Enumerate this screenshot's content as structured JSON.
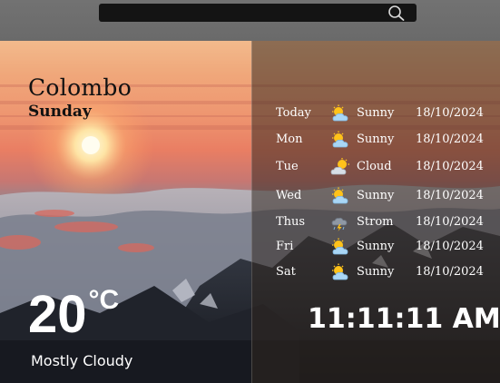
{
  "search": {
    "value": "",
    "placeholder": ""
  },
  "location": {
    "city": "Colombo",
    "day": "Sunday"
  },
  "current": {
    "temperature": "20",
    "unit": "°C",
    "condition": "Mostly Cloudy"
  },
  "clock": "11:11:11 AM",
  "forecast": [
    {
      "day": "Today",
      "condition": "Sunny",
      "date": "18/10/2024",
      "icon": "sun-cloud-icon"
    },
    {
      "day": "Mon",
      "condition": "Sunny",
      "date": "18/10/2024",
      "icon": "sun-cloud-icon"
    },
    {
      "day": "Tue",
      "condition": "Cloud",
      "date": "18/10/2024",
      "icon": "cloud-sun-icon"
    },
    {
      "day": "Wed",
      "condition": "Sunny",
      "date": "18/10/2024",
      "icon": "sun-cloud-icon"
    },
    {
      "day": "Thus",
      "condition": "Strom",
      "date": "18/10/2024",
      "icon": "storm-icon"
    },
    {
      "day": "Fri",
      "condition": "Sunny",
      "date": "18/10/2024",
      "icon": "sun-cloud-icon"
    },
    {
      "day": "Sat",
      "condition": "Sunny",
      "date": "18/10/2024",
      "icon": "sun-cloud-icon"
    }
  ]
}
